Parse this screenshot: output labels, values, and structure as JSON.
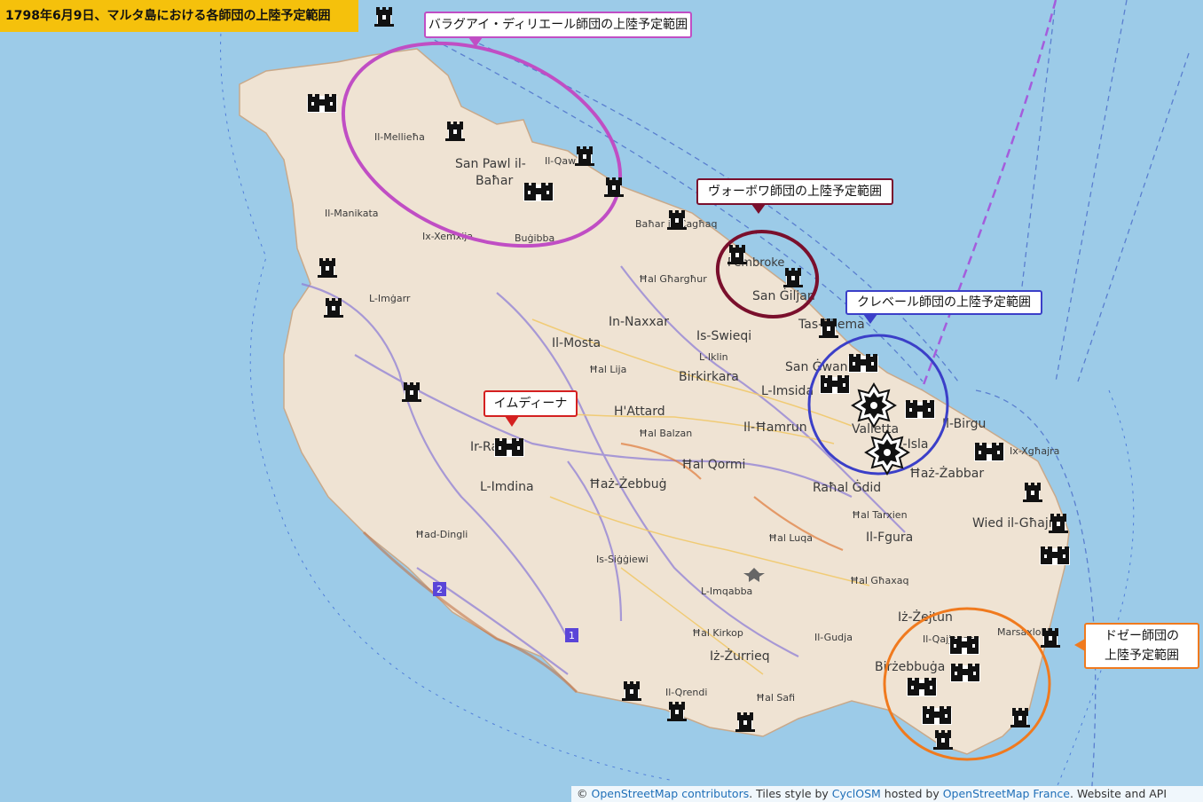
{
  "title": "1798年6月9日、マルタ島における各師団の上陸予定範囲",
  "callouts": {
    "baraguey": "バラグアイ・ディリエール師団の上陸予定範囲",
    "vaubois": "ヴォーボワ師団の上陸予定範囲",
    "kleber": "クレベール師団の上陸予定範囲",
    "mdina": "イムディーナ",
    "desaix_line1": "ドゼー師団の",
    "desaix_line2": "上陸予定範囲"
  },
  "colors": {
    "sea": "#9ccbe8",
    "land": "#efe3d3",
    "title_bg": "#f5c10c",
    "baraguey": "#c04ec4",
    "vaubois": "#7a0f2c",
    "kleber": "#3b3fc8",
    "mdina": "#d42020",
    "desaix": "#f07a1e"
  },
  "place_labels": {
    "mellieha": "Il-Mellieħa",
    "san_pawl_1": "San Pawl il-",
    "san_pawl_2": "Baħar",
    "qawra": "Il-Qaw",
    "manikata": "Il-Manikata",
    "xemxija": "Ix-Xemxija",
    "bugibba": "Buġibba",
    "bahar_caghaq": "Baħar iċ-Ċagħaq",
    "pembroke": "Pembroke",
    "san_giljan": "San Ġiljan",
    "gharghur": "Ħal Għargħur",
    "naxxar": "In-Naxxar",
    "mgarr": "L-Imġarr",
    "mosta": "Il-Mosta",
    "swieqi": "Is-Swieqi",
    "iklin": "L-Iklin",
    "lija": "Ħal Lija",
    "birkirkara": "Birkirkara",
    "tas_sliema": "Tas-Sliema",
    "san_gwann": "San Ġwann",
    "msida": "L-Imsida",
    "attard": "H'Attard",
    "rabat": "Ir-Rabat",
    "balzan": "Ħal Balzan",
    "hamrun": "Il-Ħamrun",
    "valletta": "Valletta",
    "birgu": "Il-Birgu",
    "isla": "L-Isla",
    "xghajra": "Ix-Xgħajra",
    "qormi": "Ħal Qormi",
    "zabbar": "Ħaż-Żabbar",
    "mdina_town": "L-Imdina",
    "zebbug": "Ħaż-Żebbuġ",
    "rahal_gdid": "Raħal Ġdid",
    "tarxien": "Ħal Tarxien",
    "wied_ghajn": "Wied il-Għajn",
    "dingli": "Ħad-Dingli",
    "luqa": "Ħal Luqa",
    "fgura": "Il-Fgura",
    "siggiewi": "Is-Siġġiewi",
    "ghaxaq": "Ħal Għaxaq",
    "imqabba": "L-Imqabba",
    "zejtun": "Iż-Żejtun",
    "marsaxlokk": "Marsaxlokk",
    "qajjenza": "Il-Qajjenza",
    "birzebbuga": "Birżebbuġa",
    "kirkop": "Ħal Kirkop",
    "gudja": "Il-Gudja",
    "zurrieq": "Iż-Żurrieq",
    "qrendi": "Il-Qrendi",
    "safi": "Ħal Safi"
  },
  "route_badges": {
    "r1": "1",
    "r2": "2"
  },
  "icons": {
    "tower": "tower-icon",
    "fort": "fort-icon",
    "fortress": "star-fortress-icon"
  },
  "attribution": {
    "copy": "© ",
    "osm": "OpenStreetMap contributors",
    "text1": ". Tiles style by ",
    "cyclosm": "CyclOSM",
    "text2": " hosted by ",
    "osmfr": "OpenStreetMap France",
    "text3": ". Website and API"
  }
}
